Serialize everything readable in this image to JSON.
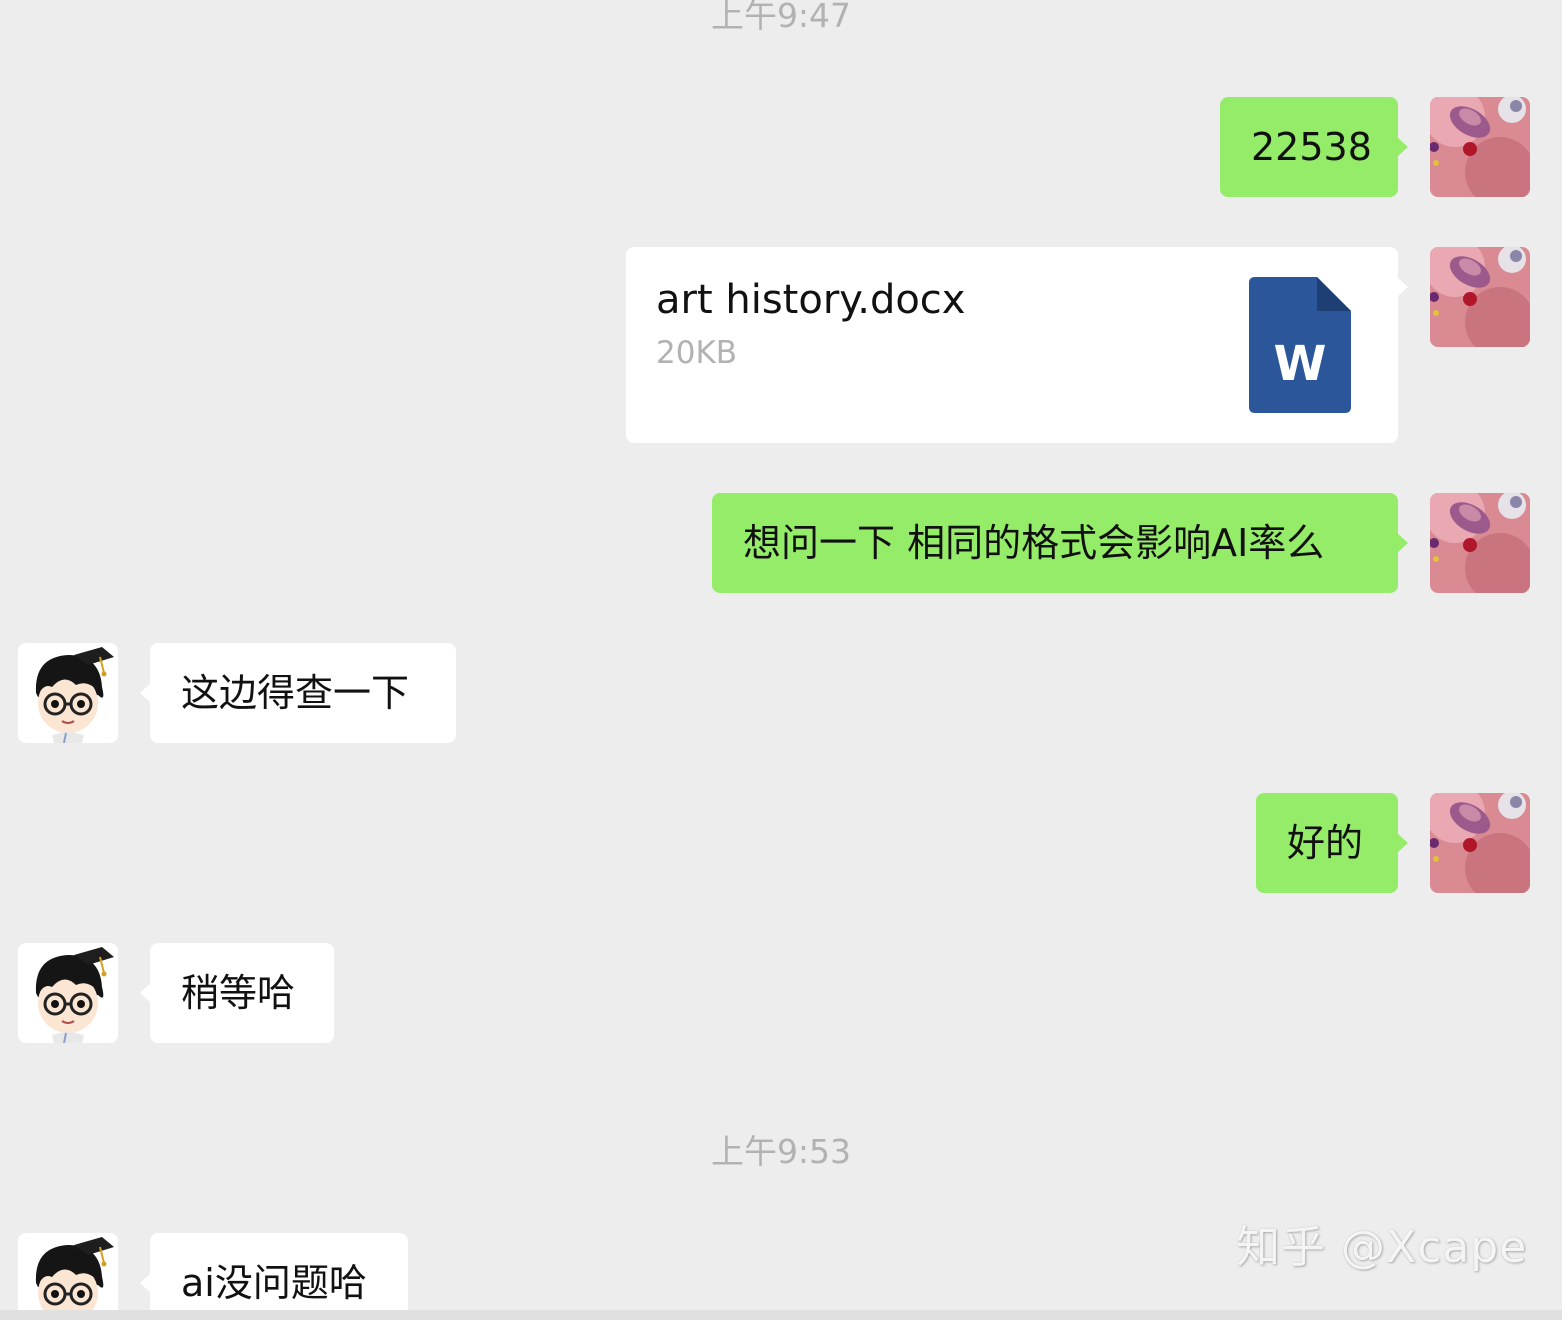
{
  "timestamps": [
    "上午9:47",
    "上午9:53"
  ],
  "messages": [
    {
      "sender": "me",
      "text": "22538"
    },
    {
      "sender": "me",
      "type": "file",
      "file_name": "art history.docx",
      "file_size": "20KB",
      "file_icon_letter": "W"
    },
    {
      "sender": "me",
      "text": "想问一下 相同的格式会影响AI率么"
    },
    {
      "sender": "them",
      "text": "这边得查一下"
    },
    {
      "sender": "me",
      "text": "好的"
    },
    {
      "sender": "them",
      "text": "稍等哈"
    },
    {
      "sender": "them",
      "text": "ai没问题哈"
    }
  ],
  "watermark": "知乎 @Xcape",
  "colors": {
    "background": "#ededed",
    "my_bubble": "#95ec69",
    "their_bubble": "#ffffff",
    "word_icon": "#2b579a"
  }
}
